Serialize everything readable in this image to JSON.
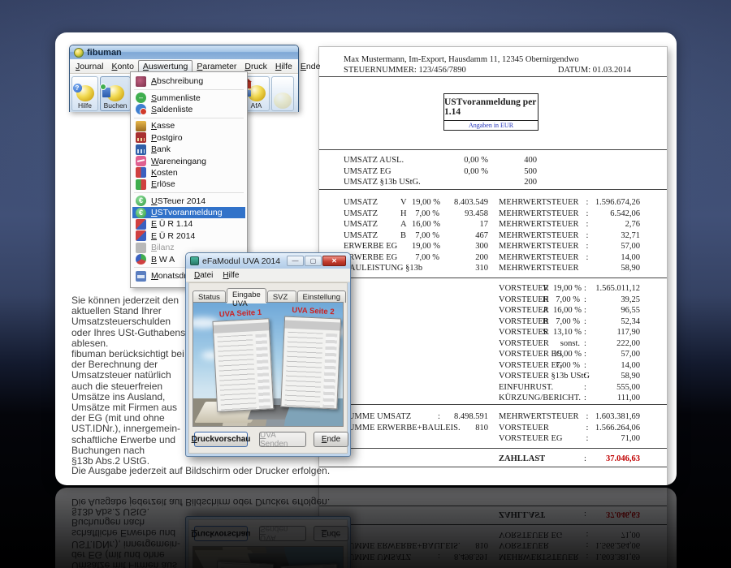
{
  "colors": {
    "highlight_blue": "#3172c9",
    "zahllast_red": "#c00000",
    "angaben_blue": "#2233bb",
    "thumb_caption_red": "#cc2222"
  },
  "main_window": {
    "title": "fibuman",
    "menubar": [
      "Journal",
      "Konto",
      "Auswertung",
      "Parameter",
      "Druck",
      "Hilfe",
      "Ende"
    ],
    "active_menu": "Auswertung",
    "toolbar": {
      "hilfe": "Hilfe",
      "buchen": "Buchen",
      "partial": "e",
      "afa": "AfA"
    }
  },
  "dropdown": {
    "items": [
      {
        "label": "Abschreibung"
      },
      {
        "label": "Summenliste"
      },
      {
        "label": "Saldenliste"
      },
      {
        "label": "Kasse"
      },
      {
        "label": "Postgiro"
      },
      {
        "label": "Bank"
      },
      {
        "label": "Wareneingang"
      },
      {
        "label": "Kosten"
      },
      {
        "label": "Erlöse"
      },
      {
        "label": "USTeuer 2014"
      },
      {
        "label": "USTvoranmeldung",
        "selected": true
      },
      {
        "label": "E Ü R 1.14"
      },
      {
        "label": "E Ü R 2014"
      },
      {
        "label": "Bilanz",
        "disabled": true
      },
      {
        "label": "B W A"
      },
      {
        "label": "Monatsdru"
      }
    ]
  },
  "dialog": {
    "title": "eFaModul UVA 2014",
    "window_buttons": {
      "minimize": "—",
      "maximize": "▢",
      "close": "✕"
    },
    "menu": [
      "Datei",
      "Hilfe"
    ],
    "tabs": [
      "Status",
      "Eingabe UVA",
      "SVZ und DFV",
      "Einstellung"
    ],
    "active_tab": "Eingabe UVA",
    "thumb1": "UVA Seite 1",
    "thumb2": "UVA Seite 2",
    "buttons": {
      "preview": "Druckvorschau",
      "send": "UVA Senden",
      "end": "Ende"
    }
  },
  "report": {
    "sender_line": "Max Mustermann, Im-Export, Hausdamm 11, 12345 Obernirgendwo",
    "tax_number": "STEUERNUMMER: 123/456/7890",
    "date": "DATUM: 01.03.2014",
    "title_box": "USTvoranmeldung per  1.14",
    "subtitle_box": "Angaben in EUR",
    "umsatz_frei": [
      {
        "label": "UMSATZ AUSL.",
        "rate": "0,00 %",
        "value": "400"
      },
      {
        "label": "UMSATZ EG",
        "rate": "0,00 %",
        "value": "500"
      },
      {
        "label": "UMSATZ §13b UStG.",
        "rate": "",
        "value": "200"
      }
    ],
    "umsatz": [
      {
        "label": "UMSATZ",
        "code": "V",
        "rate": "19,00 %",
        "value": "8.403.549",
        "rlabel": "MEHRWERTSTEUER",
        "colon": ":",
        "rvalue": "1.596.674,26"
      },
      {
        "label": "UMSATZ",
        "code": "H",
        "rate": "7,00 %",
        "value": "93.458",
        "rlabel": "MEHRWERTSTEUER",
        "colon": ":",
        "rvalue": "6.542,06"
      },
      {
        "label": "UMSATZ",
        "code": "A",
        "rate": "16,00 %",
        "value": "17",
        "rlabel": "MEHRWERTSTEUER",
        "colon": ":",
        "rvalue": "2,76"
      },
      {
        "label": "UMSATZ",
        "code": "B",
        "rate": "7,00 %",
        "value": "467",
        "rlabel": "MEHRWERTSTEUER",
        "colon": ":",
        "rvalue": "32,71"
      },
      {
        "label": "ERWERBE EG",
        "code": "",
        "rate": "19,00 %",
        "value": "300",
        "rlabel": "MEHRWERTSTEUER",
        "colon": ":",
        "rvalue": "57,00"
      },
      {
        "label": "ERWERBE EG",
        "code": "",
        "rate": "7,00 %",
        "value": "200",
        "rlabel": "MEHRWERTSTEUER",
        "colon": ":",
        "rvalue": "14,00"
      },
      {
        "label": "BAULEISTUNG §13b",
        "code": "",
        "rate": "",
        "value": "310",
        "rlabel": "MEHRWERTSTEUER",
        "colon": "",
        "rvalue": "58,90"
      }
    ],
    "vorsteuer": [
      {
        "label": "VORSTEUER",
        "code": "V",
        "rate": "19,00 %",
        "colon": ":",
        "value": "1.565.011,12"
      },
      {
        "label": "VORSTEUER",
        "code": "H",
        "rate": "7,00 %",
        "colon": ":",
        "value": "39,25"
      },
      {
        "label": "VORSTEUER",
        "code": "A",
        "rate": "16,00 %",
        "colon": ":",
        "value": "96,55"
      },
      {
        "label": "VORSTEUER",
        "code": "B",
        "rate": "7,00 %",
        "colon": ":",
        "value": "52,34"
      },
      {
        "label": "VORSTEUER",
        "code": "S",
        "rate": "13,10 %",
        "colon": ":",
        "value": "117,90"
      },
      {
        "label": "VORSTEUER",
        "code": "",
        "rate": "sonst.",
        "colon": ":",
        "value": "222,00"
      },
      {
        "label": "VORSTEUER EG",
        "code": "",
        "rate": "19,00 %",
        "colon": ":",
        "value": "57,00"
      },
      {
        "label": "VORSTEUER EG",
        "code": "",
        "rate": "7,00 %",
        "colon": ":",
        "value": "14,00"
      },
      {
        "label": "VORSTEUER §13b UStG",
        "code": "",
        "rate": "",
        "colon": ":",
        "value": "58,90"
      },
      {
        "label": "EINFUHRUST.",
        "code": "",
        "rate": "",
        "colon": ":",
        "value": "555,00"
      },
      {
        "label": "KÜRZUNG/BERICHT.",
        "code": "",
        "rate": "",
        "colon": ":",
        "value": "111,00"
      }
    ],
    "summary": [
      {
        "llabel": "SUMME UMSATZ",
        "lcolon": ":",
        "lvalue": "8.498.591",
        "rlabel": "MEHRWERTSTEUER",
        "rcolon": ":",
        "rvalue": "1.603.381,69"
      },
      {
        "llabel": "SUMME ERWERBE+BAULEIS.",
        "lcolon": ":",
        "lvalue": "810",
        "rlabel": "VORSTEUER",
        "rcolon": ":",
        "rvalue": "1.566.264,06"
      },
      {
        "llabel": "",
        "lcolon": "",
        "lvalue": "",
        "rlabel": "VORSTEUER EG",
        "rcolon": ":",
        "rvalue": "71,00"
      }
    ],
    "zahllast": {
      "label": "ZAHLLAST",
      "colon": ":",
      "value": "37.046,63"
    }
  },
  "description": "Sie können jederzeit den\naktuellen Stand Ihrer\nUmsatzsteuerschulden\noder Ihres USt-Guthabens\nablesen.\nfibuman berücksichtigt bei\nder Berechnung der\nUmsatzsteuer natürlich\nauch die steuerfreien\nUmsätze ins Ausland,\nUmsätze mit Firmen aus\nder EG (mit und ohne\nUST.IDNr.), innergemein-\nschaftliche Erwerbe und\nBuchungen nach\n§13b Abs.2 UStG.",
  "caption": "Die Ausgabe jederzeit auf Bildschirm oder Drucker erfolgen."
}
